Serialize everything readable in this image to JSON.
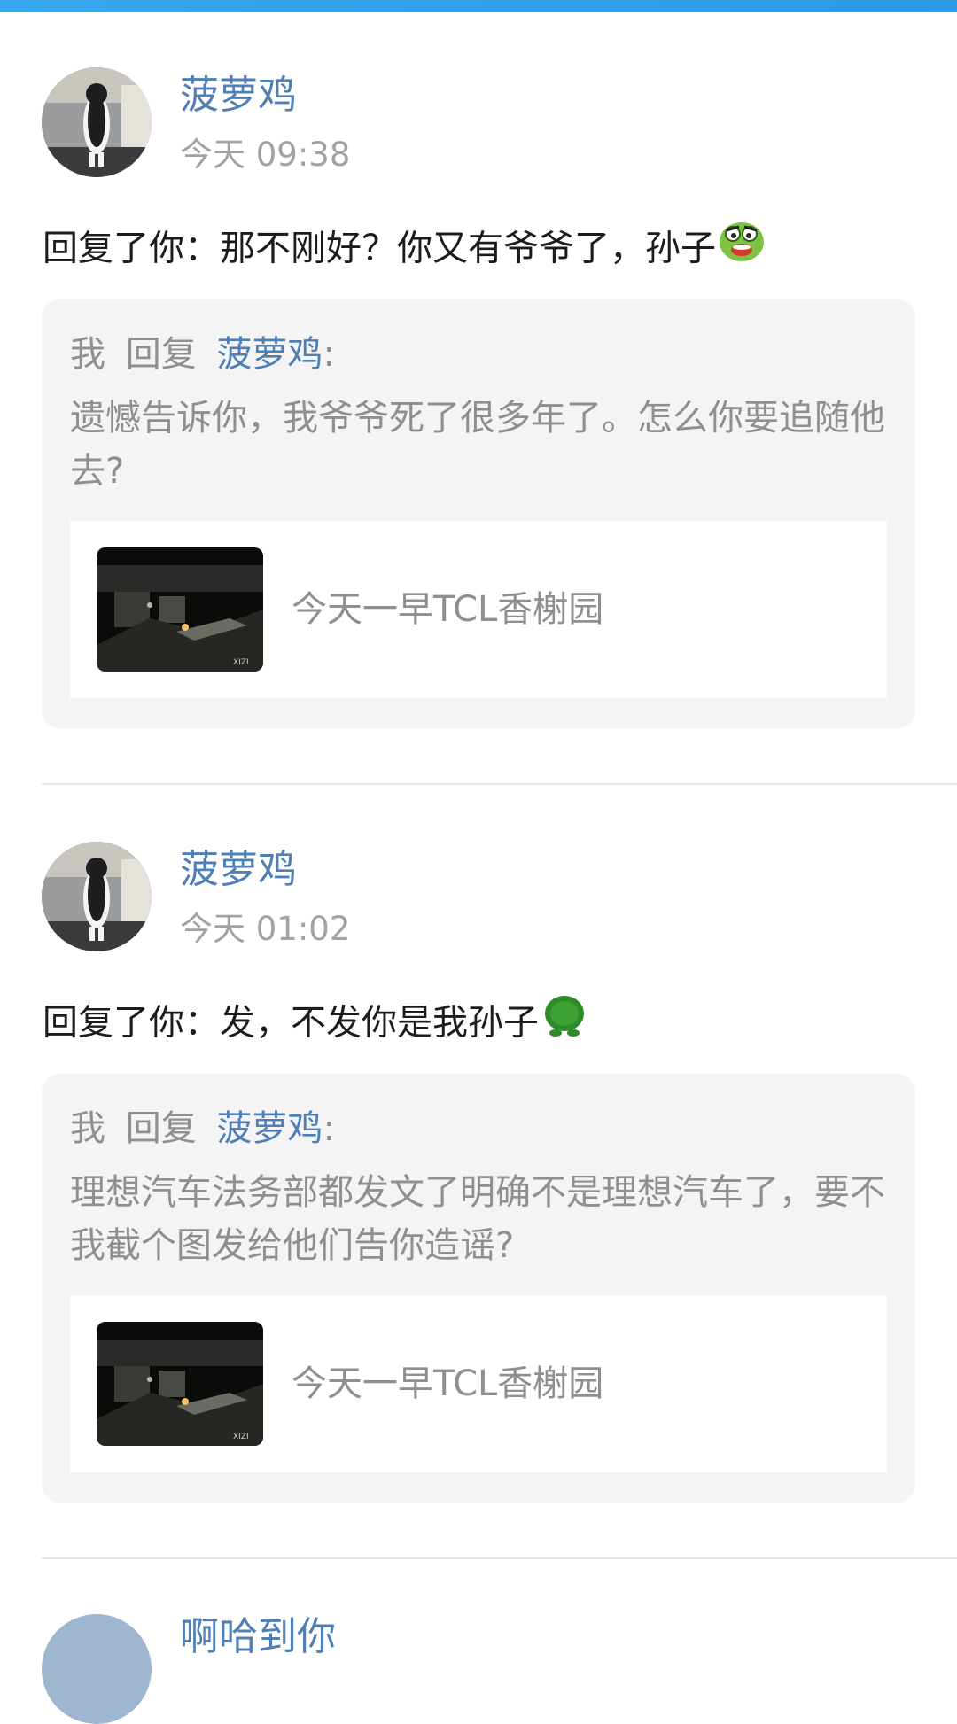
{
  "items": [
    {
      "name": "菠萝鸡",
      "time": "今天 09:38",
      "reply": "回复了你：那不刚好？你又有爷爷了，孙子",
      "emoji": "laughing-frog-emoji",
      "quote": {
        "me": "我",
        "verb": "回复",
        "target": "菠萝鸡",
        "colon": ":",
        "text": "遗憾告诉你，我爷爷死了很多年了。怎么你要追随他去?"
      },
      "link": {
        "title": "今天一早TCL香榭园",
        "watermark": "XIZI"
      }
    },
    {
      "name": "菠萝鸡",
      "time": "今天 01:02",
      "reply": "回复了你：发，不发你是我孙子",
      "emoji": "green-turtle-emoji",
      "quote": {
        "me": "我",
        "verb": "回复",
        "target": "菠萝鸡",
        "colon": ":",
        "text": "理想汽车法务部都发文了明确不是理想汽车了，要不我截个图发给他们告你造谣?"
      },
      "link": {
        "title": "今天一早TCL香榭园",
        "watermark": "XIZI"
      }
    }
  ],
  "partial_next": {
    "name": "啊哈到你"
  },
  "colors": {
    "accent_blue": "#4f7fb4",
    "top_bar": "#35a8ee",
    "quote_bg": "#f4f4f4",
    "muted_text": "#8f8f8f"
  }
}
